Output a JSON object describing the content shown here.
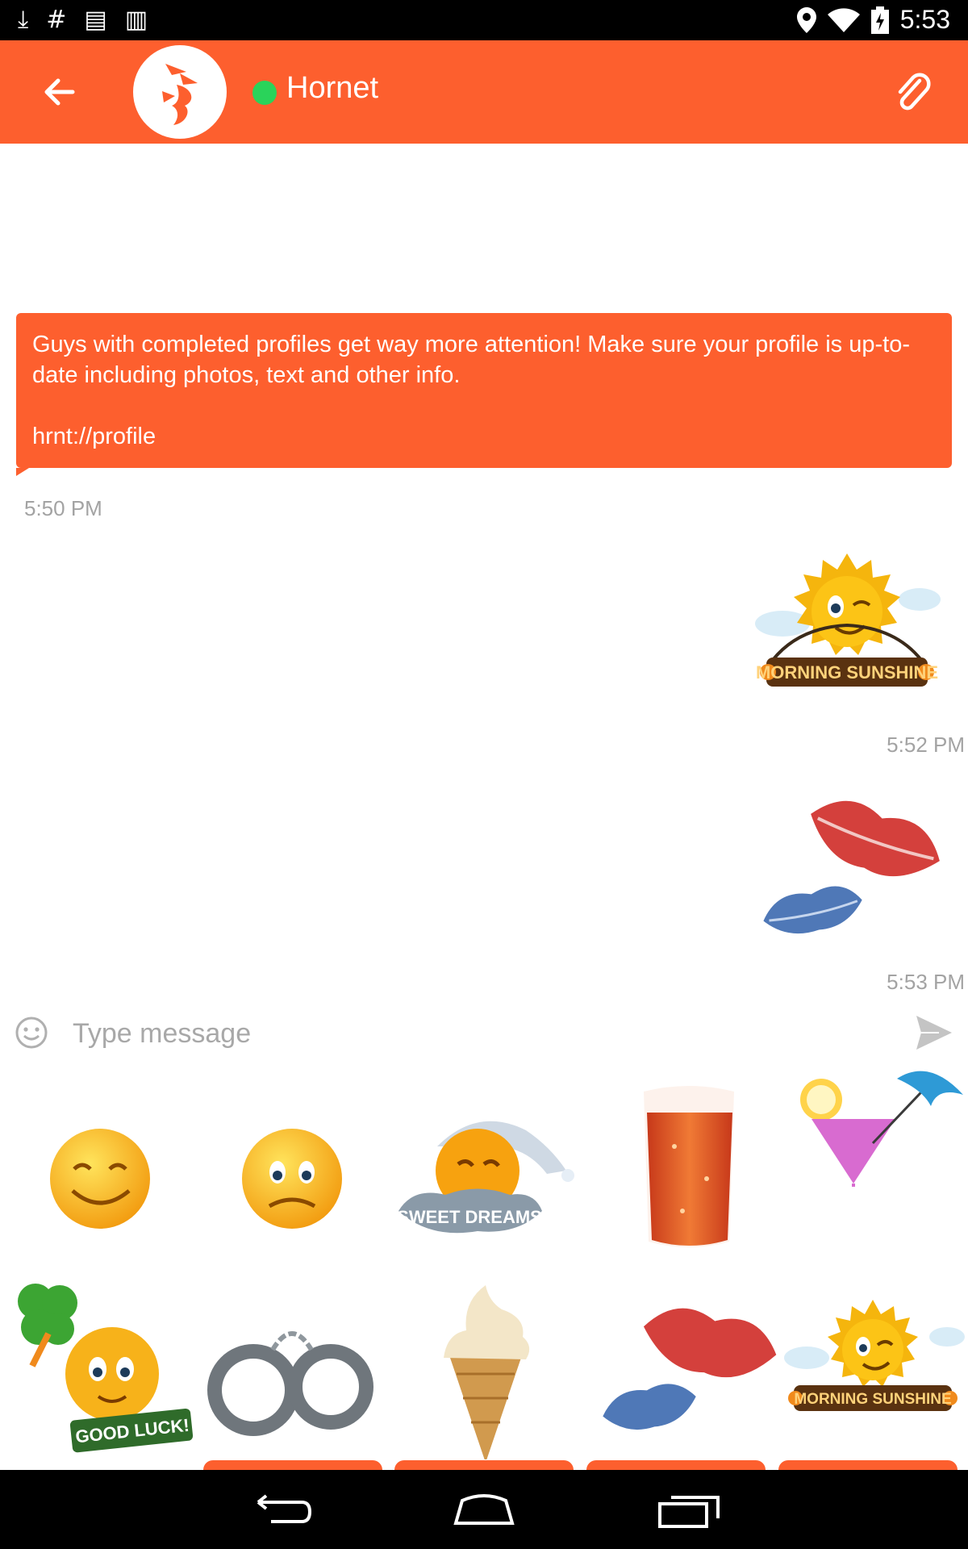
{
  "status_bar": {
    "time": "5:53",
    "left_icons": [
      "download-icon",
      "hash-icon",
      "news-icon",
      "barcode-icon"
    ],
    "right_icons": [
      "location-icon",
      "wifi-icon",
      "battery-icon"
    ]
  },
  "app_bar": {
    "title": "Hornet",
    "online_color": "#2ad35a",
    "bar_color": "#fd5f2e"
  },
  "messages": [
    {
      "type": "text",
      "line1": "Guys with completed profiles get way more attention! Make sure your profile is up-to-date including photos, text and other info.",
      "line2": "hrnt://profile",
      "time": "5:50 PM"
    },
    {
      "type": "sticker",
      "sticker": "morning-sunshine",
      "label": "MORNING SUNSHINE",
      "time": "5:52 PM"
    },
    {
      "type": "sticker",
      "sticker": "kiss-lips",
      "time": "5:53 PM"
    }
  ],
  "composer": {
    "placeholder": "Type message"
  },
  "sticker_panel": {
    "row1": [
      "smiling-emoji",
      "worried-emoji",
      "sweet-dreams",
      "beer-glass",
      "cocktail"
    ],
    "row2": [
      "good-luck",
      "handcuffs",
      "ice-cream-cone",
      "kiss-lips",
      "morning-sunshine"
    ],
    "labels": {
      "sweet_dreams": "SWEET DREAMS",
      "good_luck": "GOOD LUCK!",
      "morning_sunshine": "MORNING SUNSHINE"
    }
  },
  "nav_bar": [
    "back-icon",
    "home-icon",
    "recents-icon"
  ]
}
